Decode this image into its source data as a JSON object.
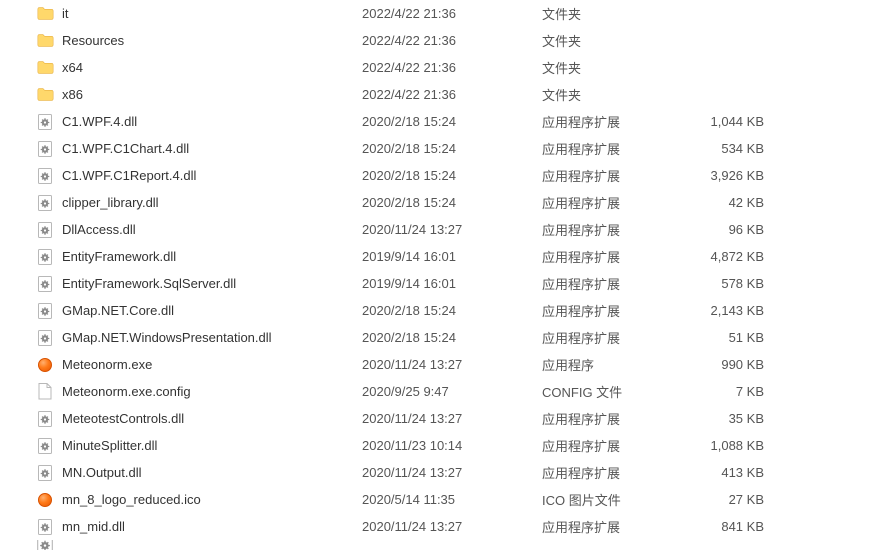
{
  "files": [
    {
      "icon": "folder",
      "name": "it",
      "date": "2022/4/22 21:36",
      "type": "文件夹",
      "size": ""
    },
    {
      "icon": "folder",
      "name": "Resources",
      "date": "2022/4/22 21:36",
      "type": "文件夹",
      "size": ""
    },
    {
      "icon": "folder",
      "name": "x64",
      "date": "2022/4/22 21:36",
      "type": "文件夹",
      "size": ""
    },
    {
      "icon": "folder",
      "name": "x86",
      "date": "2022/4/22 21:36",
      "type": "文件夹",
      "size": ""
    },
    {
      "icon": "dll",
      "name": "C1.WPF.4.dll",
      "date": "2020/2/18 15:24",
      "type": "应用程序扩展",
      "size": "1,044 KB"
    },
    {
      "icon": "dll",
      "name": "C1.WPF.C1Chart.4.dll",
      "date": "2020/2/18 15:24",
      "type": "应用程序扩展",
      "size": "534 KB"
    },
    {
      "icon": "dll",
      "name": "C1.WPF.C1Report.4.dll",
      "date": "2020/2/18 15:24",
      "type": "应用程序扩展",
      "size": "3,926 KB"
    },
    {
      "icon": "dll",
      "name": "clipper_library.dll",
      "date": "2020/2/18 15:24",
      "type": "应用程序扩展",
      "size": "42 KB"
    },
    {
      "icon": "dll",
      "name": "DllAccess.dll",
      "date": "2020/11/24 13:27",
      "type": "应用程序扩展",
      "size": "96 KB"
    },
    {
      "icon": "dll",
      "name": "EntityFramework.dll",
      "date": "2019/9/14 16:01",
      "type": "应用程序扩展",
      "size": "4,872 KB"
    },
    {
      "icon": "dll",
      "name": "EntityFramework.SqlServer.dll",
      "date": "2019/9/14 16:01",
      "type": "应用程序扩展",
      "size": "578 KB"
    },
    {
      "icon": "dll",
      "name": "GMap.NET.Core.dll",
      "date": "2020/2/18 15:24",
      "type": "应用程序扩展",
      "size": "2,143 KB"
    },
    {
      "icon": "dll",
      "name": "GMap.NET.WindowsPresentation.dll",
      "date": "2020/2/18 15:24",
      "type": "应用程序扩展",
      "size": "51 KB"
    },
    {
      "icon": "exe",
      "name": "Meteonorm.exe",
      "date": "2020/11/24 13:27",
      "type": "应用程序",
      "size": "990 KB"
    },
    {
      "icon": "file",
      "name": "Meteonorm.exe.config",
      "date": "2020/9/25 9:47",
      "type": "CONFIG 文件",
      "size": "7 KB"
    },
    {
      "icon": "dll",
      "name": "MeteotestControls.dll",
      "date": "2020/11/24 13:27",
      "type": "应用程序扩展",
      "size": "35 KB"
    },
    {
      "icon": "dll",
      "name": "MinuteSplitter.dll",
      "date": "2020/11/23 10:14",
      "type": "应用程序扩展",
      "size": "1,088 KB"
    },
    {
      "icon": "dll",
      "name": "MN.Output.dll",
      "date": "2020/11/24 13:27",
      "type": "应用程序扩展",
      "size": "413 KB"
    },
    {
      "icon": "ico",
      "name": "mn_8_logo_reduced.ico",
      "date": "2020/5/14 11:35",
      "type": "ICO 图片文件",
      "size": "27 KB"
    },
    {
      "icon": "dll",
      "name": "mn_mid.dll",
      "date": "2020/11/24 13:27",
      "type": "应用程序扩展",
      "size": "841 KB"
    }
  ]
}
